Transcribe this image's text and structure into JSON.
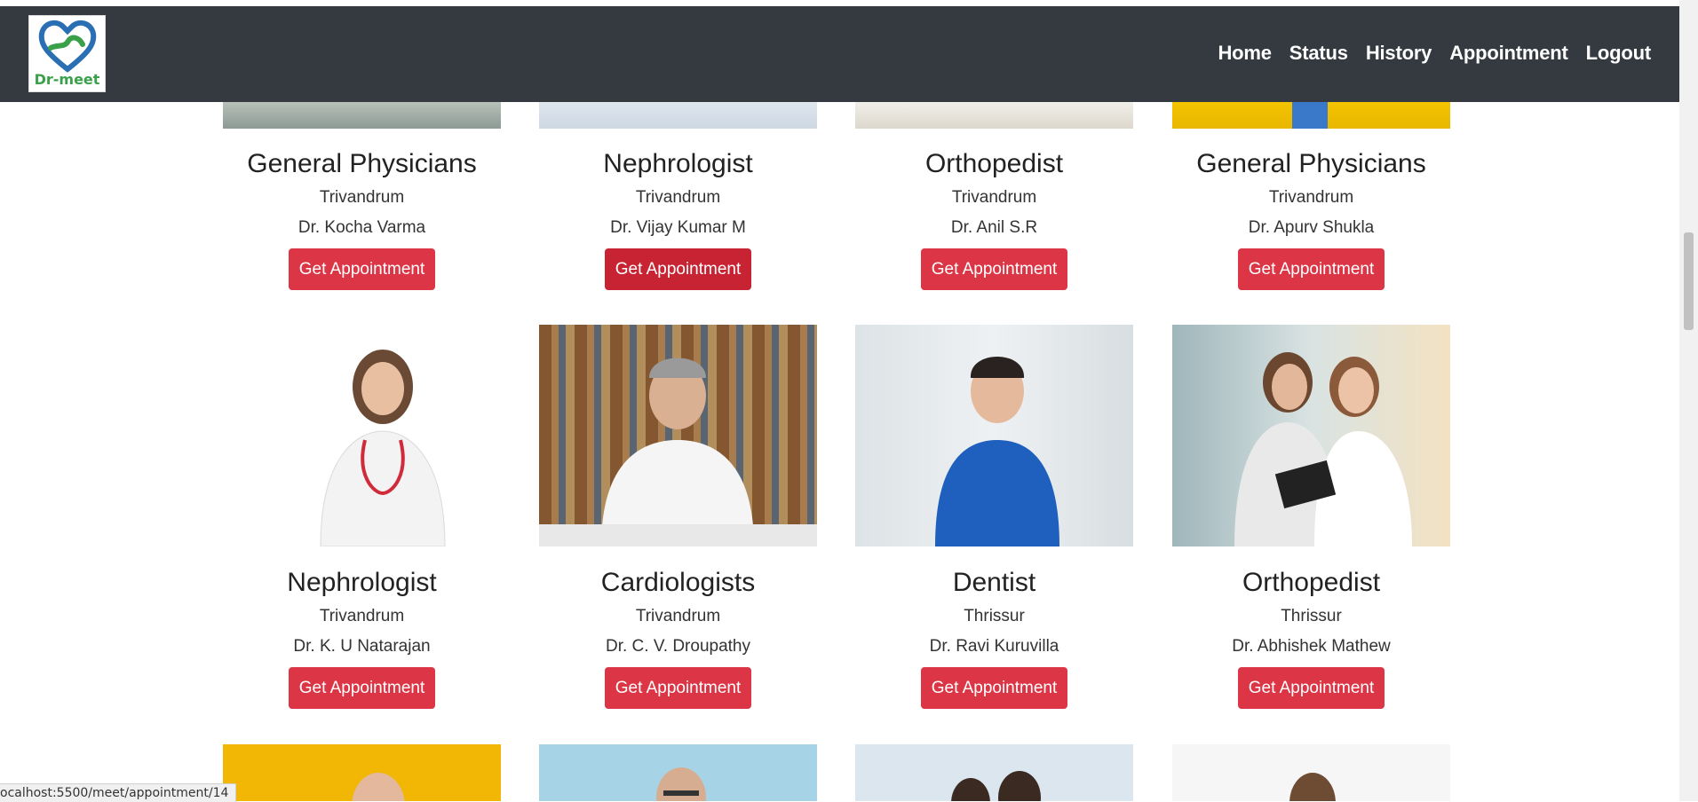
{
  "brand": {
    "name": "Dr-meet"
  },
  "nav": {
    "items": [
      {
        "label": "Home"
      },
      {
        "label": "Status"
      },
      {
        "label": "History"
      },
      {
        "label": "Appointment"
      },
      {
        "label": "Logout"
      }
    ]
  },
  "cards_row1": [
    {
      "specialty": "General Physicians",
      "city": "Trivandrum",
      "doctor": "Dr. Kocha Varma",
      "button": "Get Appointment"
    },
    {
      "specialty": "Nephrologist",
      "city": "Trivandrum",
      "doctor": "Dr. Vijay Kumar M",
      "button": "Get Appointment"
    },
    {
      "specialty": "Orthopedist",
      "city": "Trivandrum",
      "doctor": "Dr. Anil S.R",
      "button": "Get Appointment"
    },
    {
      "specialty": "General Physicians",
      "city": "Trivandrum",
      "doctor": "Dr. Apurv Shukla",
      "button": "Get Appointment"
    }
  ],
  "cards_row2": [
    {
      "specialty": "Nephrologist",
      "city": "Trivandrum",
      "doctor": "Dr. K. U Natarajan",
      "button": "Get Appointment"
    },
    {
      "specialty": "Cardiologists",
      "city": "Trivandrum",
      "doctor": "Dr. C. V. Droupathy",
      "button": "Get Appointment"
    },
    {
      "specialty": "Dentist",
      "city": "Thrissur",
      "doctor": "Dr. Ravi Kuruvilla",
      "button": "Get Appointment"
    },
    {
      "specialty": "Orthopedist",
      "city": "Thrissur",
      "doctor": "Dr. Abhishek Mathew",
      "button": "Get Appointment"
    }
  ],
  "status_bar": {
    "url": "ocalhost:5500/meet/appointment/14"
  },
  "colors": {
    "navbar": "#343a40",
    "button": "#dc3545",
    "button_active": "#c82333",
    "logo_text": "#3aa14a"
  },
  "icons": [
    "heart-logo-icon"
  ]
}
